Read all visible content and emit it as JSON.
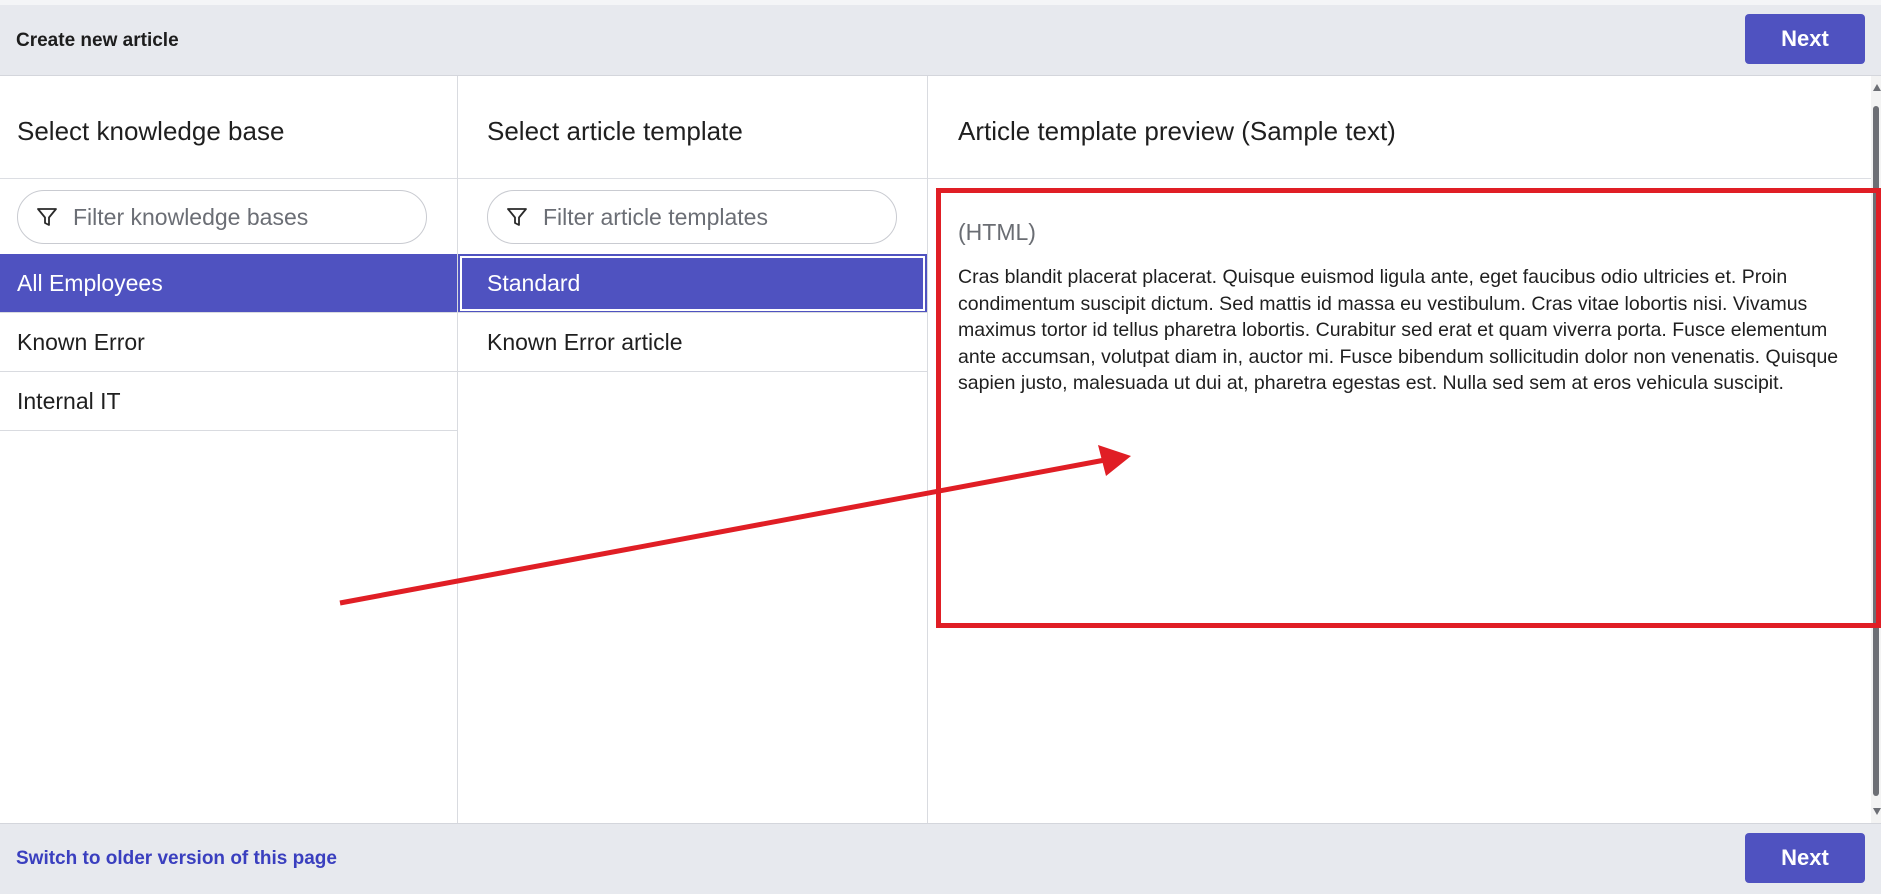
{
  "header": {
    "title": "Create new article",
    "next_label": "Next"
  },
  "knowledge_base": {
    "heading": "Select knowledge base",
    "filter_placeholder": "Filter knowledge bases",
    "items": [
      {
        "label": "All Employees",
        "selected": true
      },
      {
        "label": "Known Error",
        "selected": false
      },
      {
        "label": "Internal IT",
        "selected": false
      }
    ]
  },
  "template": {
    "heading": "Select article template",
    "filter_placeholder": "Filter article templates",
    "items": [
      {
        "label": "Standard",
        "selected": true
      },
      {
        "label": "Known Error article",
        "selected": false
      }
    ]
  },
  "preview": {
    "heading": "Article template preview (Sample text)",
    "format_tag": "(HTML)",
    "sample_text": "Cras blandit placerat placerat. Quisque euismod ligula ante, eget faucibus odio ultricies et. Proin condimentum suscipit dictum. Sed mattis id massa eu vestibulum. Cras vitae lobortis nisi. Vivamus maximus tortor id tellus pharetra lobortis. Curabitur sed erat et quam viverra porta. Fusce elementum ante accumsan, volutpat diam in, auctor mi. Fusce bibendum sollicitudin dolor non venenatis. Quisque sapien justo, malesuada ut dui at, pharetra egestas est. Nulla sed sem at eros vehicula suscipit."
  },
  "footer": {
    "switch_link": "Switch to older version of this page",
    "next_label": "Next"
  },
  "colors": {
    "accent": "#4f52c0",
    "annotation": "#e01e25",
    "bar_bg": "#e7e9ee",
    "link": "#3a3fbf"
  }
}
